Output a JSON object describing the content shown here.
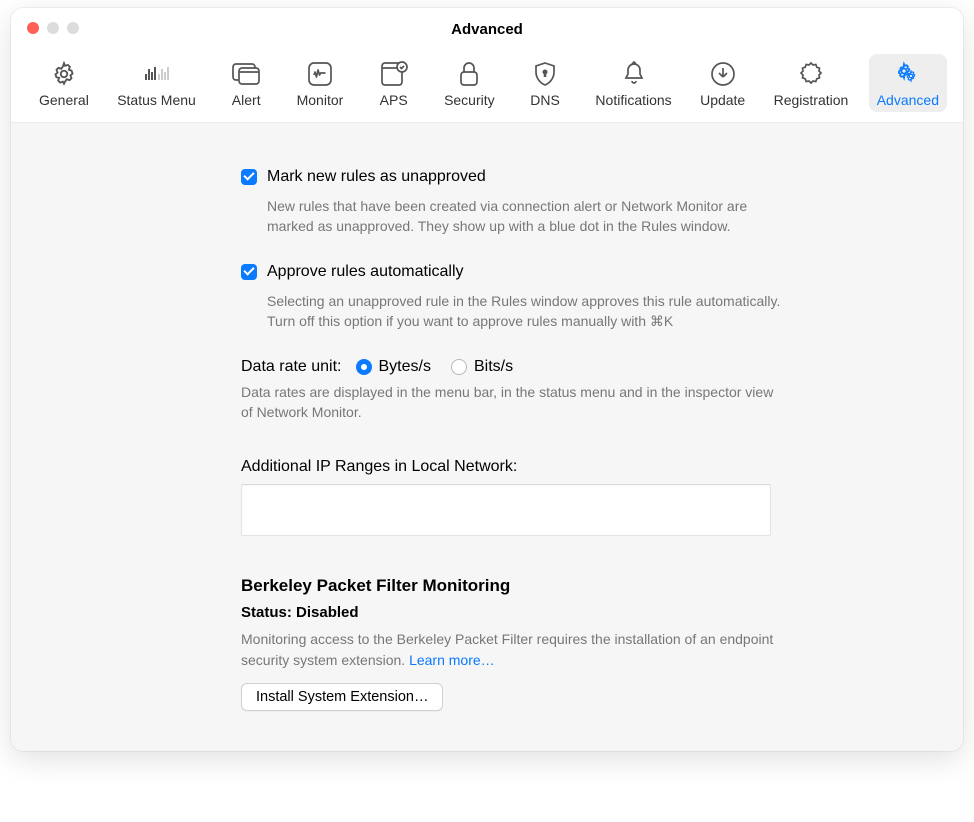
{
  "window": {
    "title": "Advanced"
  },
  "tabs": {
    "general": "General",
    "status_menu": "Status Menu",
    "alert": "Alert",
    "monitor": "Monitor",
    "aps": "APS",
    "security": "Security",
    "dns": "DNS",
    "notifications": "Notifications",
    "update": "Update",
    "registration": "Registration",
    "advanced": "Advanced"
  },
  "opt1": {
    "label": "Mark new rules as unapproved",
    "desc": "New rules that have been created via connection alert or Network Monitor are marked as unapproved. They show up with a blue dot in the Rules window.",
    "checked": true
  },
  "opt2": {
    "label": "Approve rules automatically",
    "desc": "Selecting an unapproved rule in the Rules window approves this rule automatically. Turn off this option if you want to approve rules manually with ⌘K",
    "checked": true
  },
  "datarate": {
    "label": "Data rate unit:",
    "bytes": "Bytes/s",
    "bits": "Bits/s",
    "desc": "Data rates are displayed in the menu bar, in the status menu and in the inspector view of Network Monitor."
  },
  "ipranges": {
    "label": "Additional IP Ranges in Local Network:",
    "value": ""
  },
  "bpf": {
    "heading": "Berkeley Packet Filter Monitoring",
    "status": "Status: Disabled",
    "desc": "Monitoring access to the Berkeley Packet Filter requires the installation of an endpoint security system extension. ",
    "learn_more": "Learn more…",
    "button": "Install System Extension…"
  }
}
